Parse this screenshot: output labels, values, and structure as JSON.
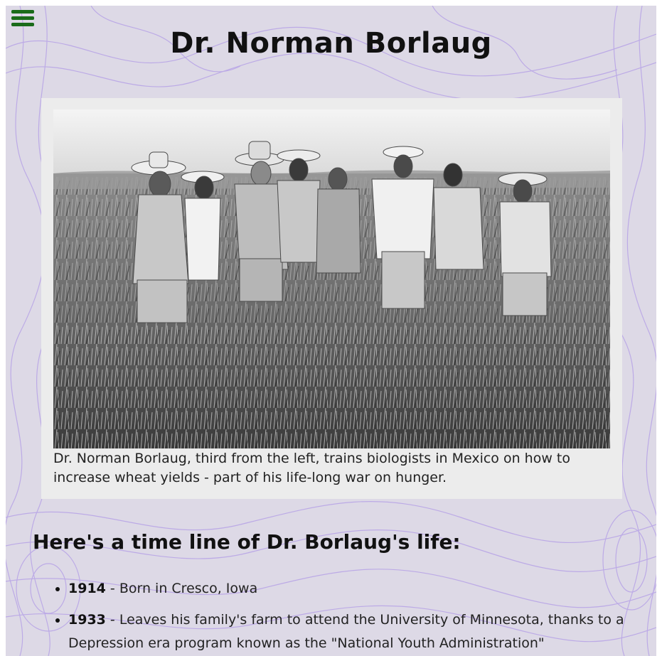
{
  "colors": {
    "background": "#ddd9e6",
    "contour_lines": "#b9a6e6",
    "menu_icon": "#1a6b1a",
    "figure_background": "#ececec"
  },
  "nav": {
    "menu_icon": "hamburger-menu-icon"
  },
  "header": {
    "title": "Dr. Norman Borlaug"
  },
  "figure": {
    "image_subject": "black-and-white photo of nine men in hats standing in a wheat field",
    "caption": "Dr. Norman Borlaug, third from the left, trains biologists in Mexico on how to increase wheat yields - part of his life-long war on hunger."
  },
  "timeline": {
    "heading": "Here's a time line of Dr. Borlaug's life:",
    "items": [
      {
        "year": "1914",
        "text": " - Born in Cresco, Iowa"
      },
      {
        "year": "1933",
        "text": " - Leaves his family's farm to attend the University of Minnesota, thanks to a Depression era program known as the \"National Youth Administration\""
      }
    ]
  }
}
